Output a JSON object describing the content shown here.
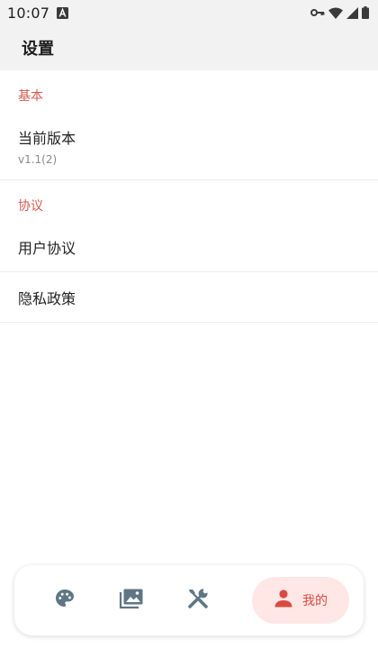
{
  "status_bar": {
    "time": "10:07",
    "icons": [
      "notification-a-icon",
      "vpn-key-icon",
      "wifi-icon",
      "cell-signal-icon",
      "battery-icon"
    ]
  },
  "header": {
    "title": "设置"
  },
  "sections": [
    {
      "header": "基本",
      "items": [
        {
          "title": "当前版本",
          "subtitle": "v1.1(2)"
        }
      ]
    },
    {
      "header": "协议",
      "items": [
        {
          "title": "用户协议"
        },
        {
          "title": "隐私政策"
        }
      ]
    }
  ],
  "bottom_nav": {
    "items": [
      {
        "icon": "palette-icon",
        "active": false
      },
      {
        "icon": "image-icon",
        "active": false
      },
      {
        "icon": "tools-icon",
        "active": false
      },
      {
        "icon": "person-icon",
        "label": "我的",
        "active": true
      }
    ]
  },
  "colors": {
    "accent": "#d45c52",
    "active_bg": "#ffe7e5",
    "icon_gray": "#5f7684",
    "header_bg": "#f2f2f2"
  }
}
